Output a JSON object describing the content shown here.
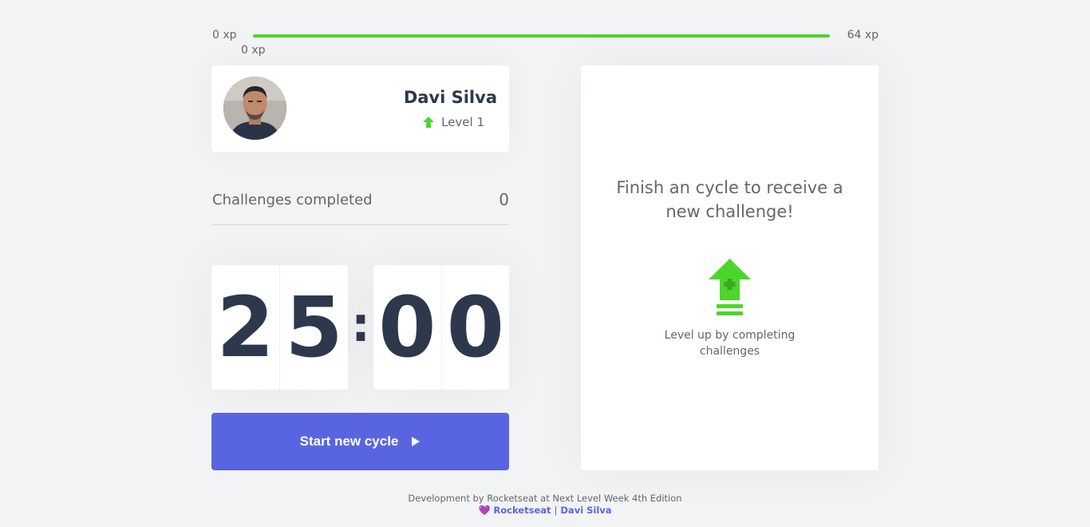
{
  "xp": {
    "min_label": "0 xp",
    "max_label": "64 xp",
    "current_label": "0 xp",
    "progress_fraction": 1.0,
    "bar_color": "#4cd62b"
  },
  "profile": {
    "name": "Davi Silva",
    "level_label": "Level 1",
    "level_icon": "level-up-arrow-icon"
  },
  "challenges": {
    "label": "Challenges completed",
    "count": "0"
  },
  "countdown": {
    "minute_tens": "2",
    "minute_ones": "5",
    "separator": ":",
    "second_tens": "0",
    "second_ones": "0"
  },
  "start_button": {
    "label": "Start new cycle",
    "icon": "play-icon",
    "color": "#5965e0"
  },
  "challenge_card": {
    "title": "Finish an cycle to receive a new challenge!",
    "icon": "level-up-icon",
    "hint": "Level up by completing challenges"
  },
  "footer": {
    "line1": "Development by Rocketseat at Next Level Week 4th Edition",
    "heart": "💜",
    "link1": "Rocketseat",
    "separator": "|",
    "link2": "Davi Silva"
  }
}
